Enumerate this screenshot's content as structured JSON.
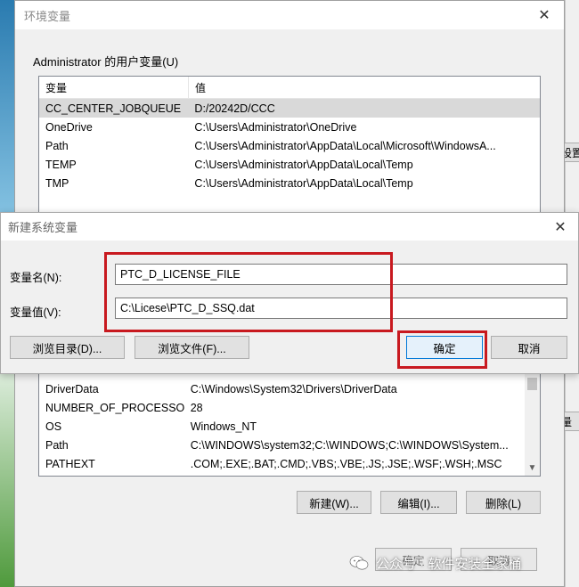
{
  "env_window": {
    "title": "环境变量",
    "user_group_label": "Administrator 的用户变量(U)",
    "columns": [
      "变量",
      "值"
    ],
    "user_vars": [
      {
        "name": "CC_CENTER_JOBQUEUE",
        "value": "D:/20242D/CCC"
      },
      {
        "name": "OneDrive",
        "value": "C:\\Users\\Administrator\\OneDrive"
      },
      {
        "name": "Path",
        "value": "C:\\Users\\Administrator\\AppData\\Local\\Microsoft\\WindowsA..."
      },
      {
        "name": "TEMP",
        "value": "C:\\Users\\Administrator\\AppData\\Local\\Temp"
      },
      {
        "name": "TMP",
        "value": "C:\\Users\\Administrator\\AppData\\Local\\Temp"
      }
    ],
    "system_vars": [
      {
        "name": "DriverData",
        "value": "C:\\Windows\\System32\\Drivers\\DriverData"
      },
      {
        "name": "NUMBER_OF_PROCESSORS",
        "value": "28"
      },
      {
        "name": "OS",
        "value": "Windows_NT"
      },
      {
        "name": "Path",
        "value": "C:\\WINDOWS\\system32;C:\\WINDOWS;C:\\WINDOWS\\System..."
      },
      {
        "name": "PATHEXT",
        "value": ".COM;.EXE;.BAT;.CMD;.VBS;.VBE;.JS;.JSE;.WSF;.WSH;.MSC"
      }
    ],
    "sys_buttons": {
      "new": "新建(W)...",
      "edit": "编辑(I)...",
      "delete": "删除(L)"
    },
    "footer_buttons": {
      "ok": "确定",
      "cancel": "取消"
    }
  },
  "right_edge_labels": {
    "a": "设置",
    "b": "量"
  },
  "dialog": {
    "title": "新建系统变量",
    "name_label": "变量名(N):",
    "value_label": "变量值(V):",
    "name_value": "PTC_D_LICENSE_FILE",
    "value_value": "C:\\Licese\\PTC_D_SSQ.dat",
    "browse_dir": "浏览目录(D)...",
    "browse_file": "浏览文件(F)...",
    "ok": "确定",
    "cancel": "取消"
  },
  "highlight_color": "#c8191f",
  "watermark": "公众号 · 软件安装全家桶"
}
